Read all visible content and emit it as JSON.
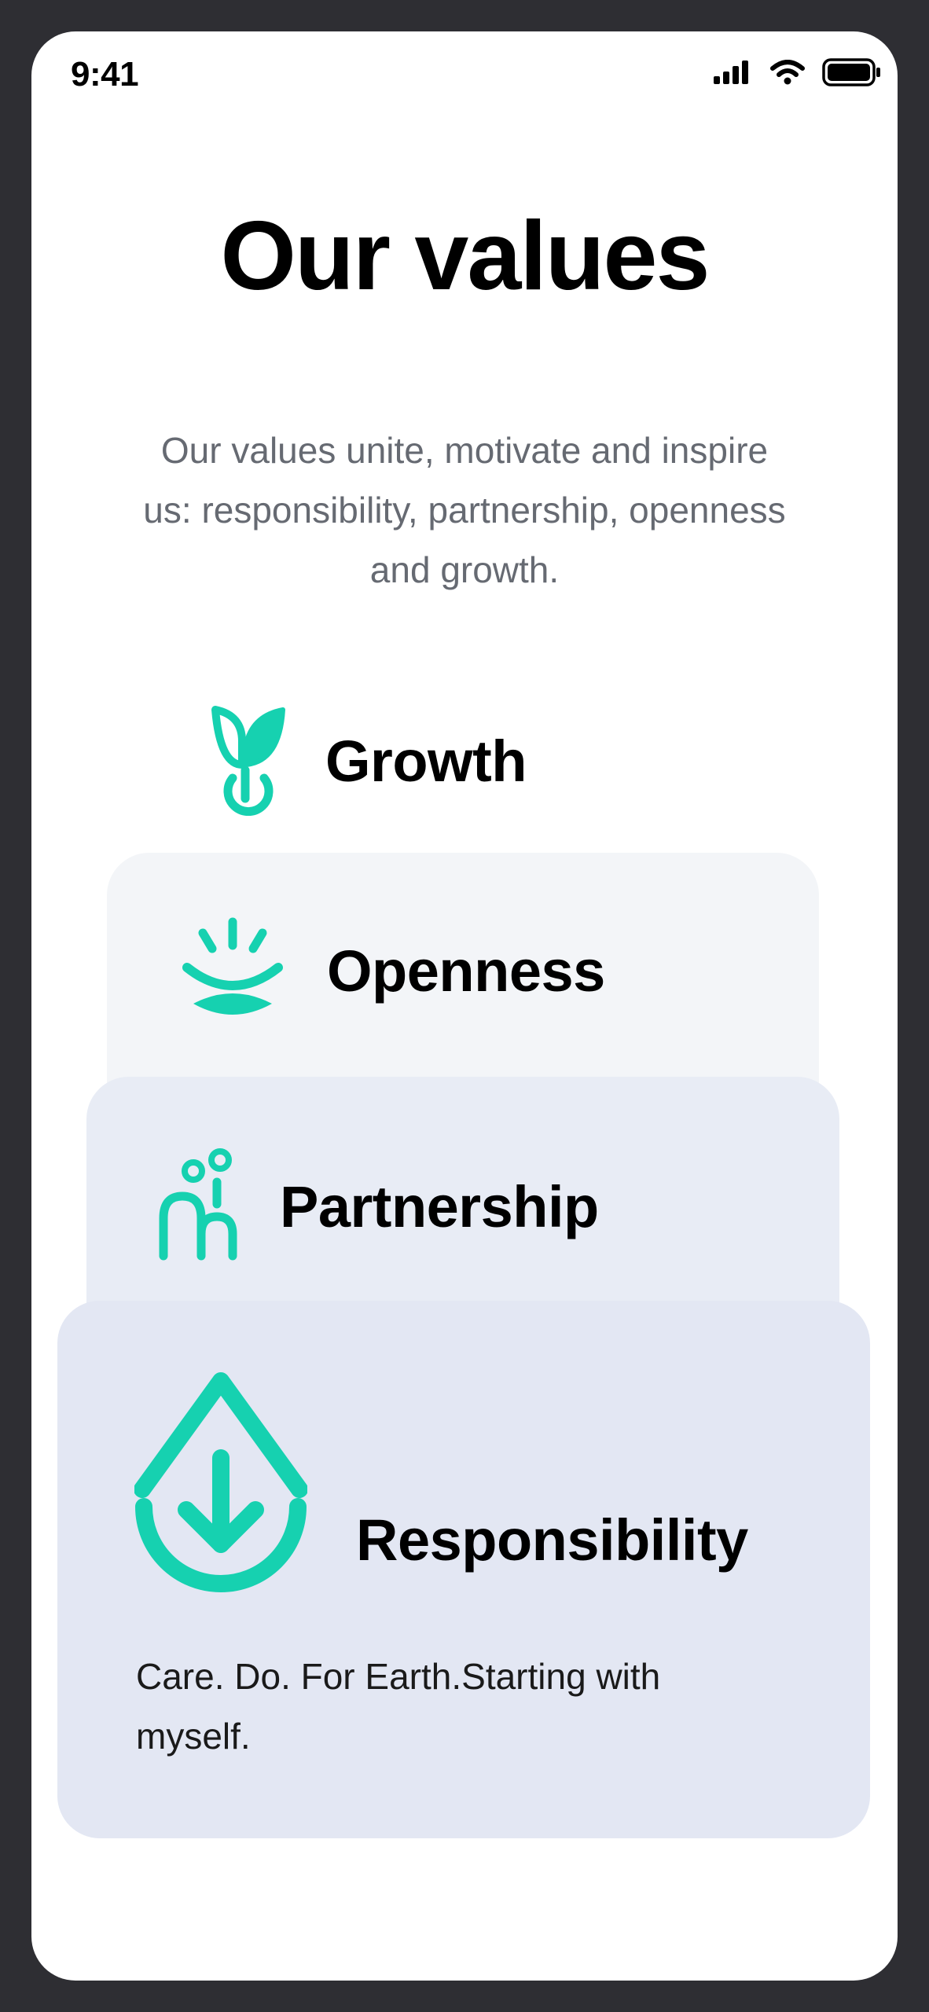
{
  "status_bar": {
    "time": "9:41",
    "icons": [
      "cellular-signal-icon",
      "wifi-icon",
      "battery-icon"
    ]
  },
  "page": {
    "title": "Our values",
    "subtitle": "Our values unite, motivate and inspire us: responsibility, partnership, openness and growth."
  },
  "values": [
    {
      "name": "Growth",
      "icon": "sprout-icon"
    },
    {
      "name": "Openness",
      "icon": "eye-icon"
    },
    {
      "name": "Partnership",
      "icon": "people-icon"
    },
    {
      "name": "Responsibility",
      "icon": "drop-arrow-icon",
      "description": "Care. Do. For Earth.Starting with myself."
    }
  ],
  "colors": {
    "accent": "#16d1b0",
    "text": "#000000",
    "muted_text": "#666a72",
    "card_openness": "#f3f5f8",
    "card_partnership": "#e8ecf5",
    "card_responsibility": "#e3e7f3"
  }
}
